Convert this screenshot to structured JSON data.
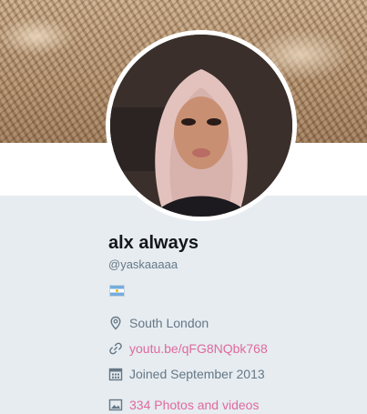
{
  "profile": {
    "name": "alx always",
    "handle": "@yaskaaaaa",
    "location": "South London",
    "website": "youtu.be/qFG8NQbk768",
    "joined": "Joined September 2013",
    "photos": "334 Photos and videos"
  },
  "icons": {
    "location": "location-pin-icon",
    "link": "link-icon",
    "calendar": "calendar-icon",
    "photos": "photo-icon",
    "flag": "argentina-flag-emoji"
  },
  "colors": {
    "link": "#e0699f",
    "muted": "#657786",
    "name": "#14171a",
    "background": "#e6ecf0"
  }
}
